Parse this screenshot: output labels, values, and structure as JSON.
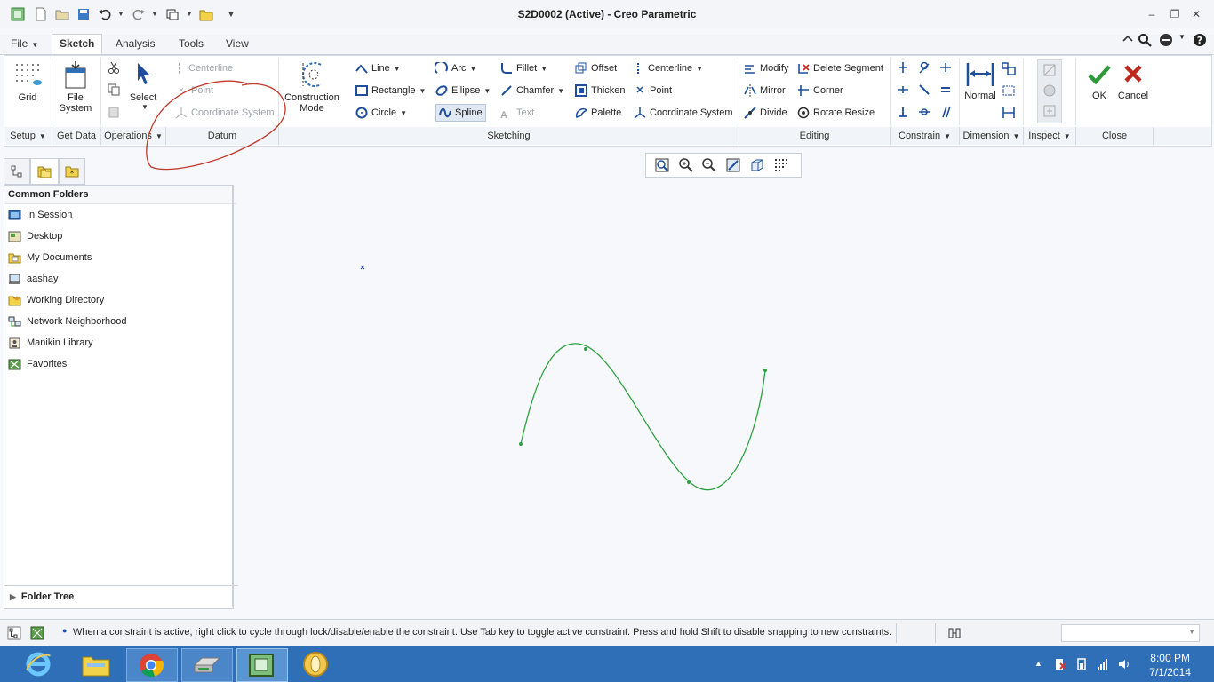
{
  "window": {
    "title": "S2D0002 (Active) - Creo Parametric"
  },
  "tabs": [
    "File",
    "Sketch",
    "Analysis",
    "Tools",
    "View"
  ],
  "active_tab": "Sketch",
  "ribbon": {
    "setup": {
      "grid": "Grid",
      "label": "Setup"
    },
    "get_data": {
      "file_system_1": "File",
      "file_system_2": "System",
      "label": "Get Data"
    },
    "operations": {
      "select": "Select",
      "label": "Operations"
    },
    "datum": {
      "centerline": "Centerline",
      "point": "Point",
      "coordinate_system": "Coordinate System",
      "label": "Datum"
    },
    "construction": {
      "line1": "Construction",
      "line2": "Mode"
    },
    "sketching": {
      "line": "Line",
      "rectangle": "Rectangle",
      "circle": "Circle",
      "arc": "Arc",
      "ellipse": "Ellipse",
      "spline": "Spline",
      "fillet": "Fillet",
      "chamfer": "Chamfer",
      "text": "Text",
      "offset": "Offset",
      "thicken": "Thicken",
      "palette": "Palette",
      "centerline": "Centerline",
      "point": "Point",
      "coordinate_system": "Coordinate System",
      "label": "Sketching"
    },
    "editing": {
      "modify": "Modify",
      "mirror": "Mirror",
      "divide": "Divide",
      "delete_segment": "Delete Segment",
      "corner": "Corner",
      "rotate_resize": "Rotate Resize",
      "label": "Editing"
    },
    "constrain": {
      "label": "Constrain"
    },
    "dimension": {
      "normal": "Normal",
      "label": "Dimension"
    },
    "inspect": {
      "label": "Inspect"
    },
    "close": {
      "ok": "OK",
      "cancel": "Cancel",
      "label": "Close"
    }
  },
  "left_panel": {
    "header": "Common Folders",
    "folders": [
      "In Session",
      "Desktop",
      "My Documents",
      "aashay",
      "Working Directory",
      "Network Neighborhood",
      "Manikin Library",
      "Favorites"
    ],
    "folder_tree": "Folder Tree"
  },
  "status": {
    "message": "When a constraint is active, right click to cycle through lock/disable/enable the constraint. Use Tab key to toggle active constraint. Press and hold Shift to disable snapping to new constraints."
  },
  "taskbar": {
    "time": "8:00 PM",
    "date": "7/1/2014"
  },
  "colors": {
    "spline": "#2ea043",
    "annotation": "#c0392b",
    "accent": "#2f6db5",
    "ok": "#2e9a3a",
    "cancel": "#c0281f"
  }
}
